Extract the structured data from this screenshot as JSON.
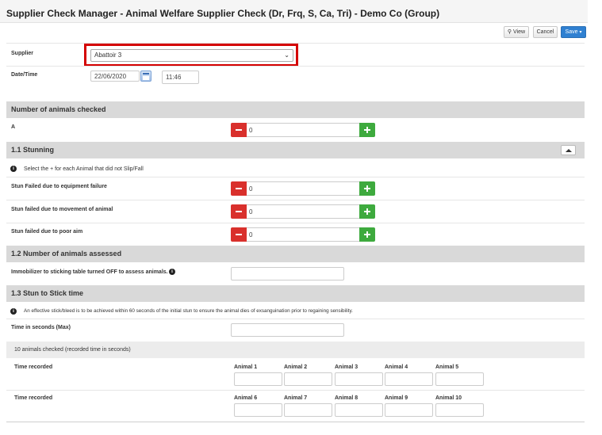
{
  "header": {
    "title": "Supplier Check Manager - Animal Welfare Supplier Check (Dr, Frq, S, Ca, Tri) - Demo Co (Group)",
    "view_label": "View",
    "cancel_label": "Cancel",
    "save_label": "Save"
  },
  "form": {
    "supplier_label": "Supplier",
    "supplier_value": "Abattoir 3",
    "datetime_label": "Date/Time",
    "date_value": "22/06/2020",
    "time_value": "11:46"
  },
  "sections": {
    "animals_checked": {
      "title": "Number of animals checked",
      "row_label": "A",
      "row_value": "0"
    },
    "stunning": {
      "title": "1.1 Stunning",
      "info": "Select the + for each Animal that did not Slip/Fall",
      "rows": [
        {
          "label": "Stun Failed due to equipment failure",
          "value": "0"
        },
        {
          "label": "Stun failed due to movement of animal",
          "value": "0"
        },
        {
          "label": "Stun failed due to poor aim",
          "value": "0"
        }
      ]
    },
    "assessed": {
      "title": "1.2 Number of animals assessed",
      "row_label": "Immobilizer to sticking table turned OFF to assess animals."
    },
    "stun_to_stick": {
      "title": "1.3 Stun to Stick time",
      "info": "An effective stick/bleed is to be achieved within 60 seconds of the initial stun to ensure the animal dies of exsanguination prior to regaining sensibility.",
      "max_label": "Time in seconds (Max)",
      "subheader": "10 animals checked (recorded time in seconds)",
      "time_recorded_label": "Time recorded",
      "animals_row1": [
        "Animal 1",
        "Animal 2",
        "Animal 3",
        "Animal 4",
        "Animal 5"
      ],
      "animals_row2": [
        "Animal 6",
        "Animal 7",
        "Animal 8",
        "Animal 9",
        "Animal 10"
      ]
    }
  }
}
